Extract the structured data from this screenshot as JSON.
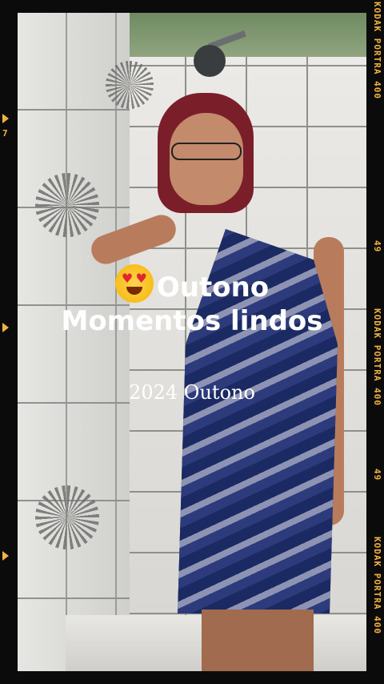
{
  "overlay": {
    "line1": "Outono",
    "line2": "Momentos lindos",
    "subtitle": "2024 Outono",
    "emoji": "heart-eyes-emoji"
  },
  "film": {
    "right_text_top": "KODAK PORTRA 400",
    "right_number_top": "49",
    "right_text_mid": "KODAK PORTRA 400",
    "right_number_mid": "49",
    "right_text_bottom": "KODAK PORTRA 400",
    "left_number": "7"
  },
  "colors": {
    "film_mark": "#f2b340",
    "background": "#0b0b0b"
  }
}
